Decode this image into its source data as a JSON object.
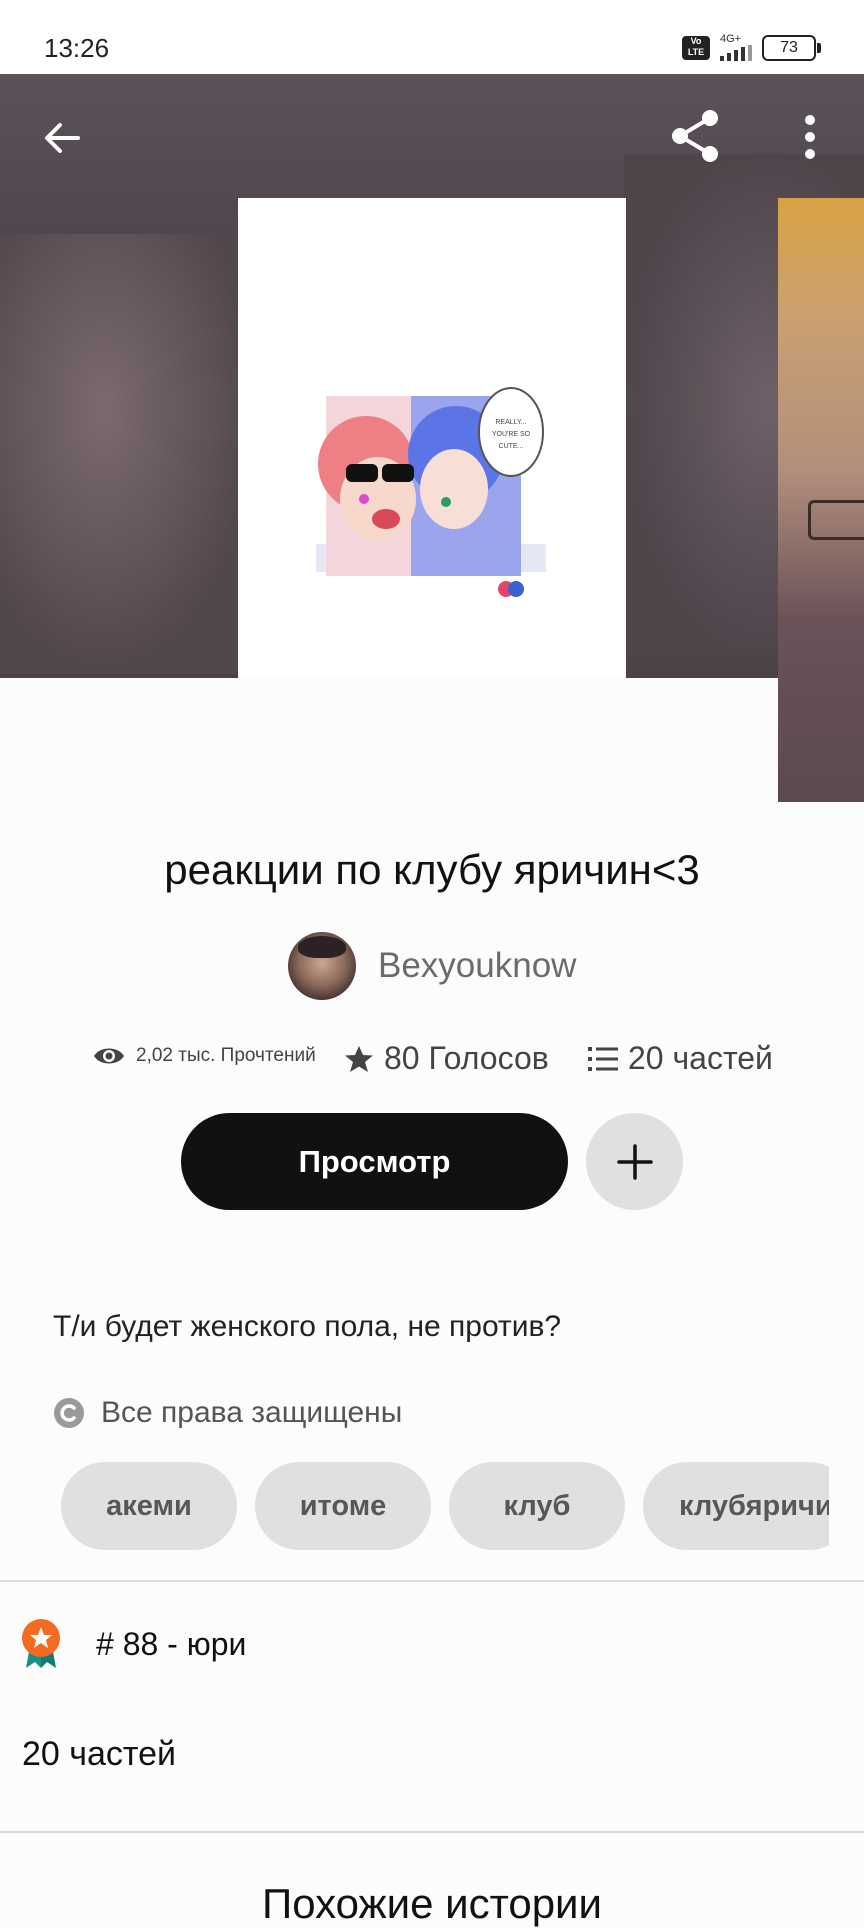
{
  "status_bar": {
    "time": "13:26",
    "volte_label": "Vo LTE",
    "network_label": "4G+",
    "battery": "73"
  },
  "story": {
    "title": "реакции по клубу яричин<3",
    "author": "Bexyouknow",
    "reads": "2,02 тыс. Прочтений",
    "votes": "80 Голосов",
    "parts": "20 частей",
    "description": "Т/и будет женского пола, не против?",
    "copyright": "Все права защищены"
  },
  "actions": {
    "read_label": "Просмотр",
    "add_label": "+"
  },
  "tags": [
    "акеми",
    "итоме",
    "клуб",
    "клубяричин"
  ],
  "ranking": {
    "label": "# 88 - юри"
  },
  "parts_section": {
    "label": "20 частей"
  },
  "similar": {
    "title": "Похожие истории"
  },
  "cover_art_text": "REALLY... YOU'RE SO CUTE...",
  "colors": {
    "primary_button": "#121012",
    "secondary_button": "#e1dfe1",
    "tag_background": "#e1dfe1",
    "rank_badge": "#f26b21"
  },
  "icons": [
    "back-arrow-icon",
    "share-icon",
    "more-vertical-icon",
    "eye-icon",
    "star-icon",
    "list-icon",
    "plus-icon",
    "copyright-icon",
    "ranking-badge-icon"
  ]
}
